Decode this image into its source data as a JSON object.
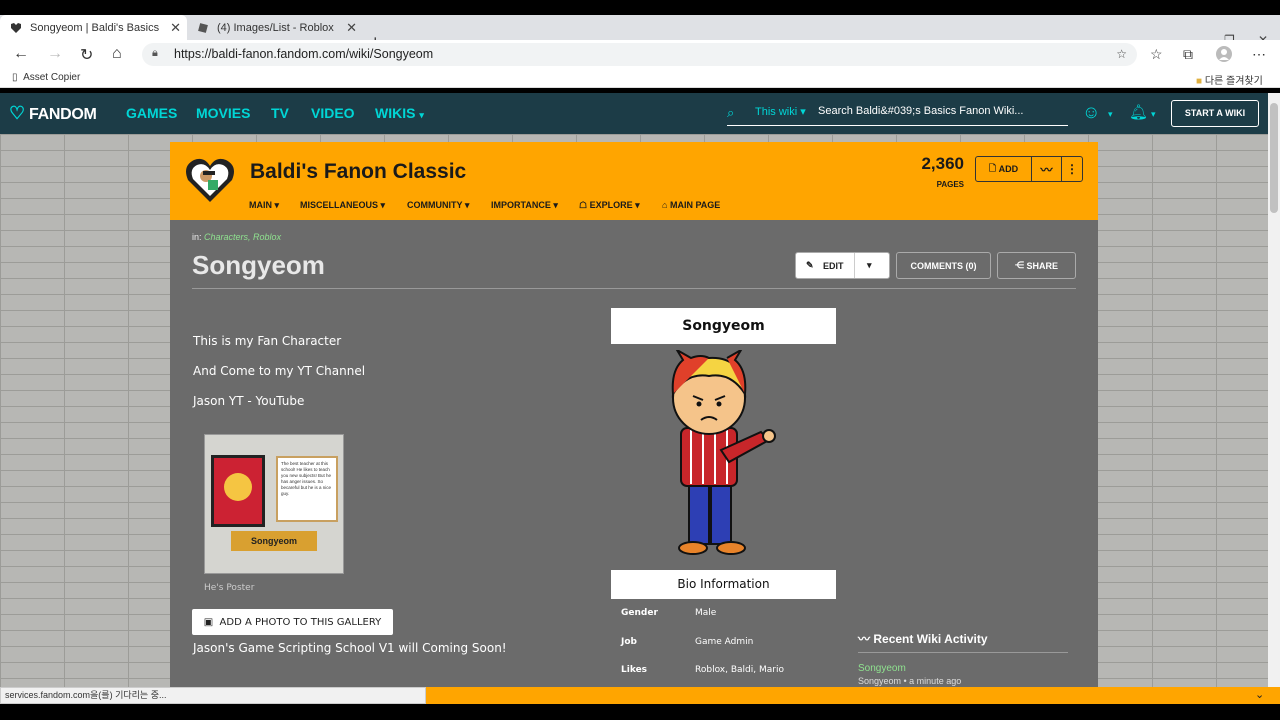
{
  "browser": {
    "tabs": [
      {
        "title": "Songyeom | Baldi's Basics Fanon",
        "active": true
      },
      {
        "title": "(4) Images/List - Roblox",
        "active": false
      }
    ],
    "url": "https://baldi-fanon.fandom.com/wiki/Songyeom",
    "favorites": {
      "left": "Asset Copier",
      "right": "다른 즐겨찾기"
    },
    "status": "services.fandom.com을(를) 기다리는 중..."
  },
  "fandom": {
    "logo": "FANDOM",
    "nav": [
      "GAMES",
      "MOVIES",
      "TV",
      "VIDEO",
      "WIKIS"
    ],
    "search_scope": "This wiki",
    "search_placeholder": "Search Baldi&#039;s Basics Fanon Wiki...",
    "start_wiki": "START A WIKI"
  },
  "wiki": {
    "name": "Baldi's Fanon Classic",
    "nav": [
      "MAIN",
      "MISCELLANEOUS",
      "COMMUNITY",
      "IMPORTANCE",
      "EXPLORE",
      "MAIN PAGE"
    ],
    "page_count": "2,360",
    "page_count_label": "PAGES",
    "add_label": "ADD"
  },
  "page": {
    "breadcrumb_prefix": "in:",
    "categories": "Characters, Roblox",
    "title": "Songyeom",
    "edit_label": "EDIT",
    "comments_label": "COMMENTS (0)",
    "share_label": "SHARE",
    "paragraphs": [
      "This is my Fan Character",
      "And Come to my YT Channel",
      "Jason YT - YouTube"
    ],
    "gallery": {
      "poster_text": "The best teacher at this school! He likes to teach you new subjects! But he has anger issues. So becareful but he is a nice guy.",
      "poster_name": "Songyeom",
      "caption": "He's Poster"
    },
    "add_photo_label": "ADD A PHOTO TO THIS GALLERY",
    "footer_text": "Jason's Game Scripting School V1 will Coming Soon!"
  },
  "infobox": {
    "title": "Songyeom",
    "section": "Bio Information",
    "rows": [
      {
        "key": "Gender",
        "value": "Male"
      },
      {
        "key": "Job",
        "value": "Game Admin"
      },
      {
        "key": "Likes",
        "value": "Roblox, Baldi, Mario"
      }
    ]
  },
  "activity": {
    "heading": "Recent Wiki Activity",
    "item_title": "Songyeom",
    "item_meta": "Songyeom • a minute ago"
  }
}
